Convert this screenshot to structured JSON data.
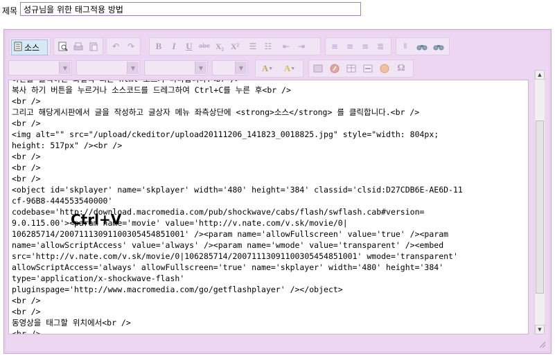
{
  "form": {
    "title_label": "제목",
    "title_value": "성규님을 위한 태그적용 방법"
  },
  "toolbar": {
    "source_label": "소스",
    "row1_icons": [
      "preview-icon",
      "print-icon",
      "paste-icon",
      "undo-icon",
      "redo-icon",
      "bold-icon",
      "italic-icon",
      "underline-icon",
      "strike-icon",
      "subscript-icon",
      "superscript-icon",
      "numbered-list-icon",
      "bulleted-list-icon",
      "outdent-icon",
      "indent-icon",
      "align-left-icon",
      "align-center-icon",
      "align-right-icon",
      "justify-icon",
      "select-all-icon",
      "find-icon",
      "replace-icon"
    ],
    "row2_icons": [
      "format-combo",
      "font-combo",
      "size-combo",
      "style-combo",
      "text-color-icon",
      "bg-color-icon",
      "image-icon",
      "flash-icon",
      "table-icon",
      "hr-icon",
      "smiley-icon",
      "special-char-icon"
    ],
    "glyphs": {
      "bold": "B",
      "italic": "I",
      "underline": "U",
      "strike": "abc",
      "subscript": "X₂",
      "superscript": "X²",
      "text_color": "A",
      "bg_color": "A",
      "omega": "Ω"
    }
  },
  "editor": {
    "overlay_text": "Ctrl+V",
    "code_lines": [
      "하단을 클릭하신 화일쪽 되는 html 소스가 나타납니다.<br />",
      "복사 하기 버튼을 누르거나 소스코드를 드레그하여 Ctrl+C를 누른 후<br />",
      "<br />",
      "그리고 해당게시판에서 글을 작성하고 글상자 메뉴 좌측상단에 <strong>소스</strong> 를 클릭합니다.<br />",
      "<br />",
      "<img alt=\"\" src=\"/upload/ckeditor/upload20111206_141823_0018825.jpg\" style=\"width: 804px;",
      "height: 517px\" /><br />",
      "<br />",
      "<br />",
      "<br />",
      "<object id='skplayer' name='skplayer' width='480' height='384' classid='clsid:D27CDB6E-AE6D-11",
      "cf-96B8-444553540000'",
      "codebase='http://download.macromedia.com/pub/shockwave/cabs/flash/swflash.cab#version=",
      "9.0.115.00'><param name='movie' value='http://v.nate.com/v.sk/movie/0|",
      "106285714/20071113091100305454851001' /><param name='allowFullscreen' value='true' /><param",
      "name='allowScriptAccess' value='always' /><param name='wmode' value='transparent' /><embed",
      "src='http://v.nate.com/v.sk/movie/0|106285714/20071113091100305454851001' wmode='transparent'",
      "allowScriptAccess='always' allowFullscreen='true' name='skplayer' width='480' height='384'",
      "type='application/x-shockwave-flash'",
      "pluginspage='http://www.macromedia.com/go/getflashplayer' /></object>",
      "<br />",
      "<br />",
      "동영상을 태그할 위치에서<br />",
      "<br />"
    ]
  },
  "colors": {
    "frame": "#e8d0ee",
    "toolbar_group": "#f1e4f4",
    "source_button": "#d7e8f6",
    "disabled_icon": "#b79cc4"
  }
}
